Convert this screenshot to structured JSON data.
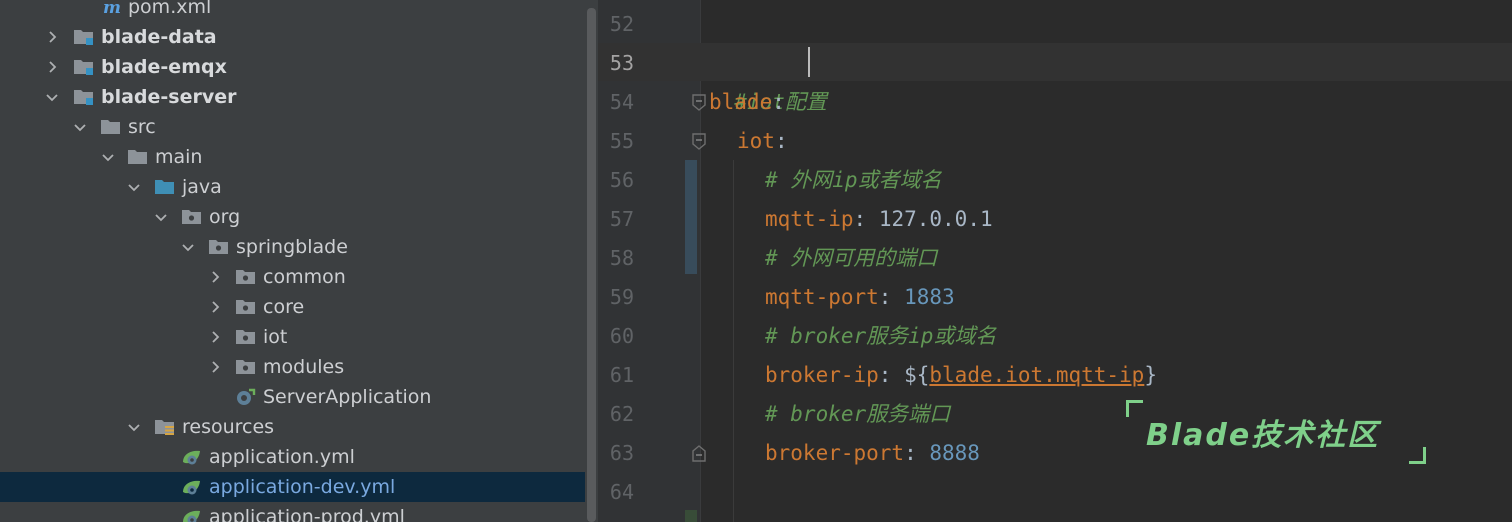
{
  "tree": {
    "items": [
      {
        "label": "pom.xml",
        "icon": "maven-file-icon"
      },
      {
        "label": "blade-data",
        "icon": "module-folder-icon",
        "expanded": false
      },
      {
        "label": "blade-emqx",
        "icon": "module-folder-icon",
        "expanded": false
      },
      {
        "label": "blade-server",
        "icon": "module-folder-icon",
        "expanded": true
      },
      {
        "label": "src",
        "icon": "folder-icon",
        "expanded": true
      },
      {
        "label": "main",
        "icon": "folder-icon",
        "expanded": true
      },
      {
        "label": "java",
        "icon": "source-folder-icon",
        "expanded": true
      },
      {
        "label": "org",
        "icon": "package-icon",
        "expanded": true
      },
      {
        "label": "springblade",
        "icon": "package-icon",
        "expanded": true
      },
      {
        "label": "common",
        "icon": "package-icon",
        "expanded": false
      },
      {
        "label": "core",
        "icon": "package-icon",
        "expanded": false
      },
      {
        "label": "iot",
        "icon": "package-icon",
        "expanded": false
      },
      {
        "label": "modules",
        "icon": "package-icon",
        "expanded": false
      },
      {
        "label": "ServerApplication",
        "icon": "spring-boot-class-icon"
      },
      {
        "label": "resources",
        "icon": "resources-folder-icon",
        "expanded": true
      },
      {
        "label": "application.yml",
        "icon": "spring-yaml-icon"
      },
      {
        "label": "application-dev.yml",
        "icon": "spring-yaml-icon",
        "selected": true
      },
      {
        "label": "application-prod.yml",
        "icon": "spring-yaml-icon"
      }
    ]
  },
  "editor": {
    "current_line": "53",
    "lines": [
      {
        "num": "52"
      },
      {
        "num": "53",
        "comment": "#iot配置"
      },
      {
        "num": "54",
        "key": "blade",
        "sep": ":"
      },
      {
        "num": "55",
        "key": "iot",
        "sep": ":"
      },
      {
        "num": "56",
        "comment": "# 外网ip或者域名"
      },
      {
        "num": "57",
        "key": "mqtt-ip",
        "sep": ": ",
        "value": "127.0.0.1"
      },
      {
        "num": "58",
        "comment": "# 外网可用的端口"
      },
      {
        "num": "59",
        "key": "mqtt-port",
        "sep": ": ",
        "value": "1883"
      },
      {
        "num": "60",
        "comment": "# broker服务ip或域名"
      },
      {
        "num": "61",
        "key": "broker-ip",
        "sep": ": ",
        "open": "${",
        "ref": "blade.iot.mqtt-ip",
        "close": "}"
      },
      {
        "num": "62",
        "comment": "# broker服务端口"
      },
      {
        "num": "63",
        "key": "broker-port",
        "sep": ": ",
        "value": "8888"
      },
      {
        "num": "64"
      }
    ]
  },
  "watermark": {
    "text": "Blade技术社区"
  },
  "colors": {
    "tree_bg": "#3c3f41",
    "editor_bg": "#2b2b2b",
    "selection_bg": "#0d293e",
    "yaml_key": "#cc7832",
    "comment": "#629755",
    "number": "#6897bb",
    "watermark": "#7fd08a"
  }
}
